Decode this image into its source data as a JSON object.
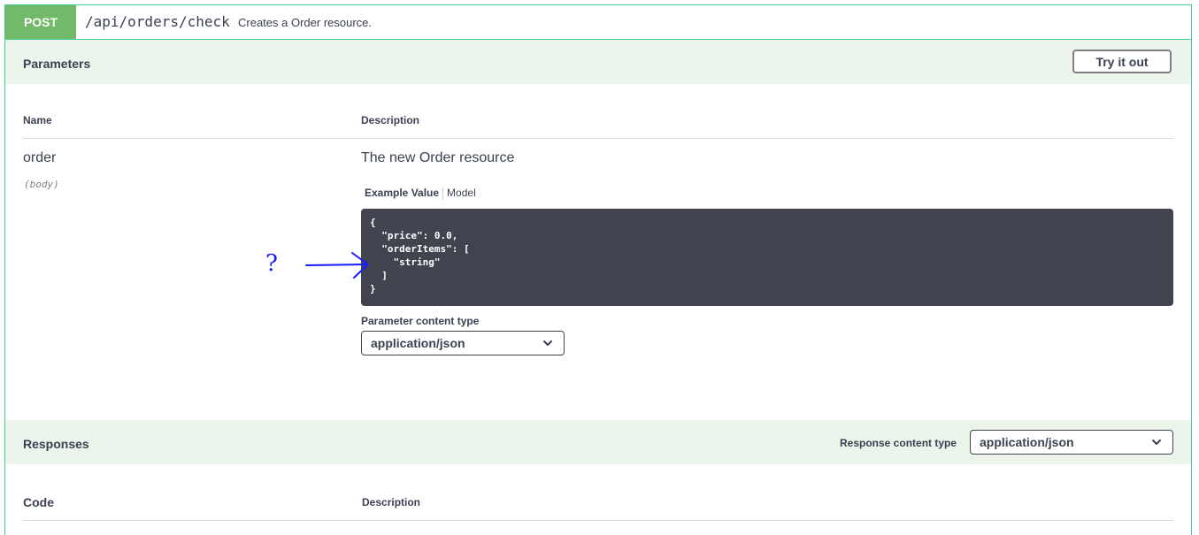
{
  "operation": {
    "method": "POST",
    "path": "/api/orders/check",
    "summary": "Creates a Order resource."
  },
  "parameters": {
    "title": "Parameters",
    "try_button": "Try it out",
    "columns": {
      "name": "Name",
      "description": "Description"
    },
    "param": {
      "name": "order",
      "location": "(body)",
      "description": "The new Order resource",
      "tabs": {
        "active": "Example Value",
        "other": "Model"
      },
      "example_value": "{\n  \"price\": 0.0,\n  \"orderItems\": [\n    \"string\"\n  ]\n}",
      "content_type_label": "Parameter content type",
      "content_type_selected": "application/json"
    }
  },
  "responses": {
    "title": "Responses",
    "content_type_label": "Response content type",
    "content_type_selected": "application/json",
    "columns": {
      "code": "Code",
      "description": "Description"
    }
  },
  "annotation": {
    "text": "?",
    "icon": "hand-drawn-arrow-icon",
    "color": "#1a1aff"
  },
  "colors": {
    "post": "#73b96a",
    "post_border": "#49cc90",
    "section_bg": "#ebf5ec",
    "code_bg": "#41444e"
  }
}
